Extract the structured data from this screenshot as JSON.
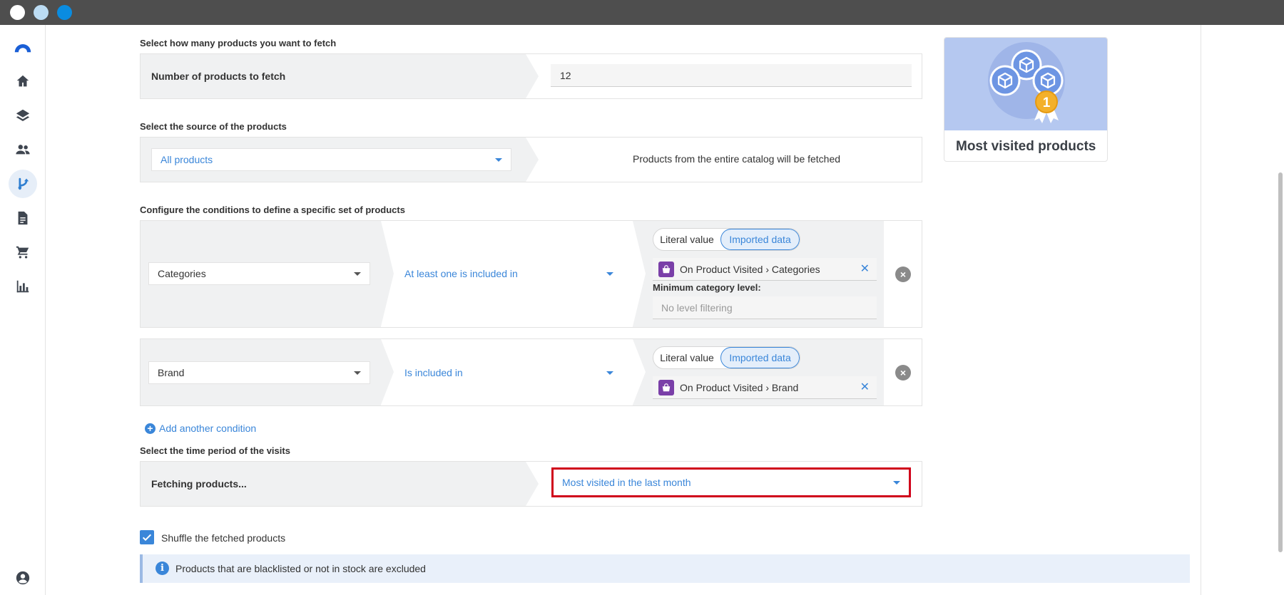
{
  "window": {
    "traffic_colors": [
      "#ffffff",
      "#bcdcf3",
      "#0a8ce0"
    ]
  },
  "sidebar": {
    "items": [
      {
        "name": "logo-icon"
      },
      {
        "name": "home-icon"
      },
      {
        "name": "layers-icon"
      },
      {
        "name": "people-icon"
      },
      {
        "name": "flow-icon",
        "active": true
      },
      {
        "name": "document-icon"
      },
      {
        "name": "cart-icon"
      },
      {
        "name": "chart-icon"
      },
      {
        "name": "account-icon"
      }
    ]
  },
  "fetch": {
    "section_label": "Select how many products you want to fetch",
    "field_label": "Number of products to fetch",
    "value": "12"
  },
  "source": {
    "section_label": "Select the source of the products",
    "selected": "All products",
    "description": "Products from the entire catalog will be fetched"
  },
  "conditions": {
    "section_label": "Configure the conditions to define a specific set of products",
    "items": [
      {
        "attribute": "Categories",
        "operator": "At least one is included in",
        "toggle_literal": "Literal value",
        "toggle_imported": "Imported data",
        "tag": "On Product Visited › Categories",
        "min_level_label": "Minimum category level:",
        "min_level_placeholder": "No level filtering"
      },
      {
        "attribute": "Brand",
        "operator": "Is included in",
        "toggle_literal": "Literal value",
        "toggle_imported": "Imported data",
        "tag": "On Product Visited › Brand"
      }
    ],
    "add_label": "Add another condition"
  },
  "period": {
    "section_label": "Select the time period of the visits",
    "field_label": "Fetching products...",
    "selected": "Most visited in the last month"
  },
  "shuffle": {
    "label": "Shuffle the fetched products",
    "checked": true
  },
  "info": {
    "text": "Products that are blacklisted or not in stock are excluded"
  },
  "card": {
    "title": "Most visited products",
    "badge": "1"
  },
  "colors": {
    "accent": "#3a86d9",
    "highlight": "#d0021b",
    "tag_icon": "#7a3fa8"
  }
}
